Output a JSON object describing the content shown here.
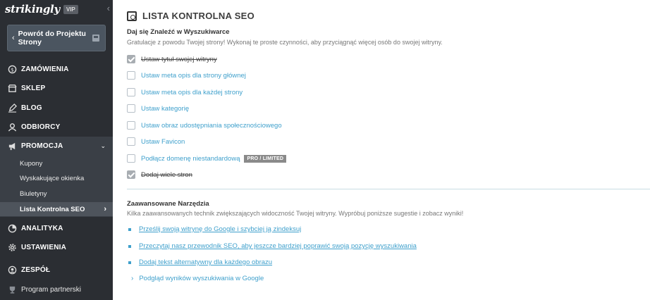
{
  "sidebar": {
    "logo": "strikingly",
    "vip_badge": "VIP",
    "back_button": "Powrót do Projektu Strony",
    "nav": [
      {
        "label": "ZAMÓWIENIA",
        "icon": "dollar-icon"
      },
      {
        "label": "SKLEP",
        "icon": "store-icon"
      },
      {
        "label": "BLOG",
        "icon": "pen-icon"
      },
      {
        "label": "ODBIORCY",
        "icon": "user-icon"
      },
      {
        "label": "PROMOCJA",
        "icon": "megaphone-icon"
      },
      {
        "label": "ANALITYKA",
        "icon": "chart-icon"
      },
      {
        "label": "USTAWIENIA",
        "icon": "gear-icon"
      },
      {
        "label": "ZESPÓŁ",
        "icon": "team-icon"
      }
    ],
    "promo_sub": [
      "Kupony",
      "Wyskakujące okienka",
      "Biuletyny",
      "Lista Kontrolna SEO"
    ],
    "partner": "Program partnerski"
  },
  "main": {
    "title": "LISTA KONTROLNA SEO",
    "find_section": {
      "title": "Daj się Znaleźć w Wyszukiwarce",
      "desc": "Gratulacje z powodu Twojej strony! Wykonaj te proste czynności, aby przyciągnąć więcej osób do swojej witryny.",
      "items": [
        {
          "label": "Ustaw tytuł swojej witryny",
          "done": true
        },
        {
          "label": "Ustaw meta opis dla strony głównej",
          "done": false
        },
        {
          "label": "Ustaw meta opis dla każdej strony",
          "done": false
        },
        {
          "label": "Ustaw kategorię",
          "done": false
        },
        {
          "label": "Ustaw obraz udostępniania społecznościowego",
          "done": false
        },
        {
          "label": "Ustaw Favicon",
          "done": false
        },
        {
          "label": "Podłącz domenę niestandardową",
          "done": false
        },
        {
          "label": "Dodaj wiele stron",
          "done": true
        }
      ],
      "pro_badge": "PRO / LIMITED"
    },
    "tools_section": {
      "title": "Zaawansowane Narzędzia",
      "desc": "Kilka zaawansowanych technik zwiększających widoczność Twojej witryny. Wypróbuj poniższe sugestie i zobacz wyniki!",
      "links": [
        "Prześlij swoją witrynę do Google i szybciej ją zindeksuj",
        "Przeczytaj nasz przewodnik SEO, aby jeszcze bardziej poprawić swoją pozycję wyszukiwania",
        "Dodaj tekst alternatywny dla każdego obrazu"
      ],
      "preview": "Podgląd wyników wyszukiwania w Google"
    }
  },
  "colors": {
    "sidebar_bg": "#2b2e33",
    "accent": "#3fa0cc"
  }
}
